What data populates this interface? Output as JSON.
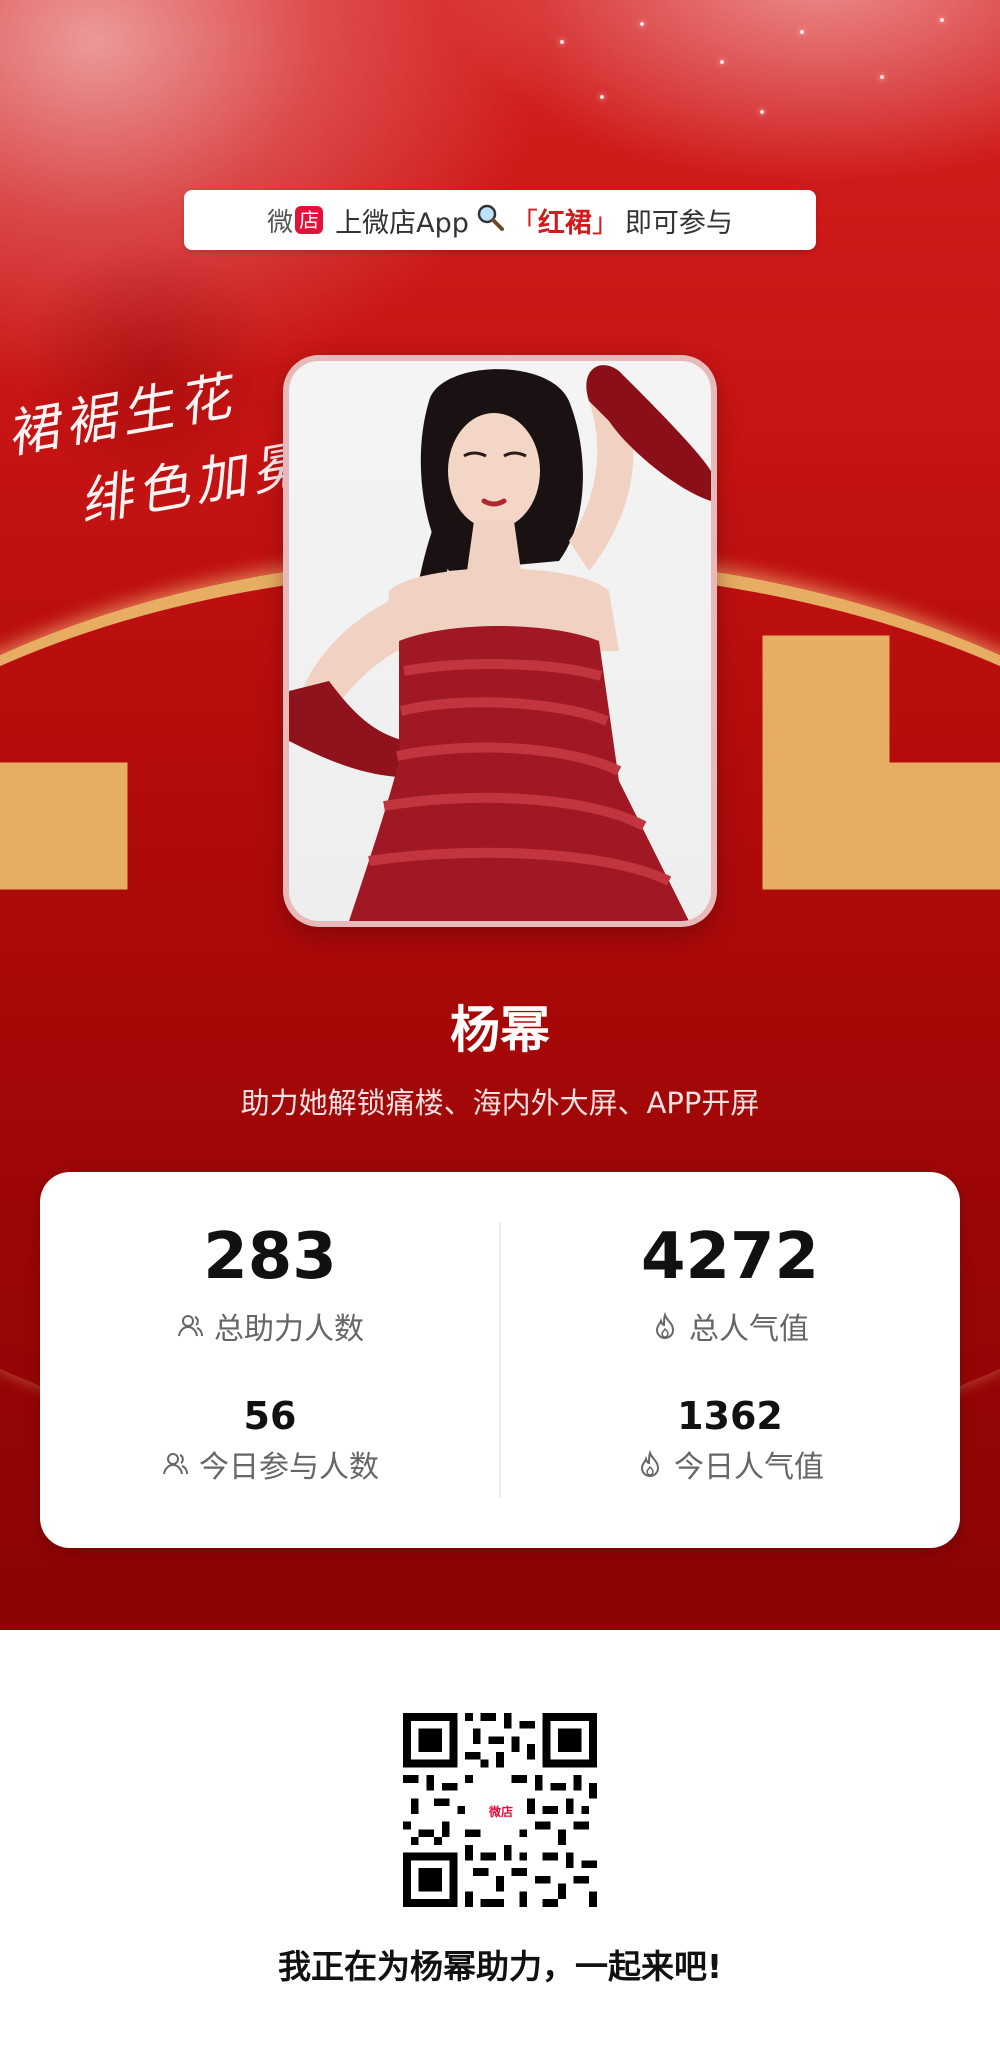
{
  "banner": {
    "logo_wei": "微",
    "logo_dian": "店",
    "text_prefix": "上微店App",
    "bracket_open": "「",
    "keyword": "红裙",
    "bracket_close": "」",
    "text_suffix": "即可参与"
  },
  "script_text": {
    "line1": "裙裾生花",
    "line2": "绯色加冕"
  },
  "profile": {
    "name": "杨幂",
    "subtitle": "助力她解锁痛楼、海内外大屏、APP开屏"
  },
  "stats": {
    "total_supporters": {
      "value": "283",
      "label": "总助力人数",
      "icon": "user-icon"
    },
    "total_popularity": {
      "value": "4272",
      "label": "总人气值",
      "icon": "flame-icon"
    },
    "today_participants": {
      "value": "56",
      "label": "今日参与人数",
      "icon": "user-icon"
    },
    "today_popularity": {
      "value": "1362",
      "label": "今日人气值",
      "icon": "flame-icon"
    }
  },
  "qr": {
    "logo_text": "微店"
  },
  "slogan": "我正在为杨幂助力，一起来吧!",
  "colors": {
    "primary_red": "#c81414",
    "gold": "#e6ad63",
    "brand_red": "#e4123a"
  }
}
